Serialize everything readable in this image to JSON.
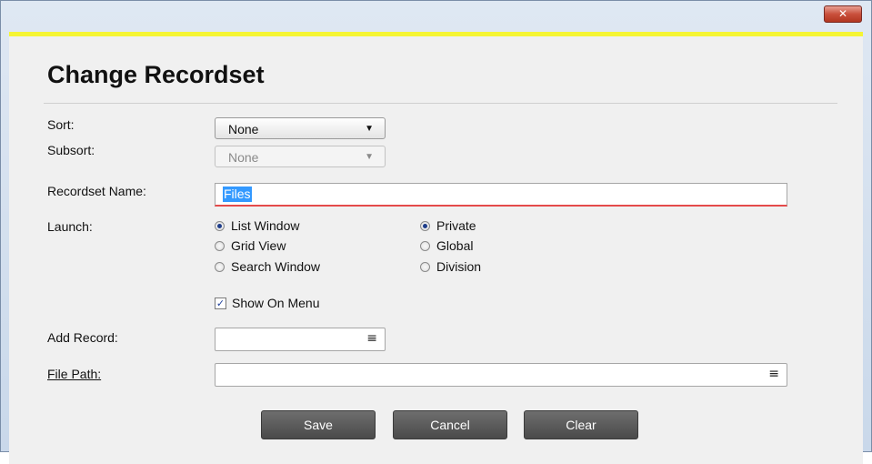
{
  "window": {
    "close_glyph": "✕"
  },
  "title": "Change Recordset",
  "fields": {
    "sort": {
      "label": "Sort:",
      "value": "None"
    },
    "subsort": {
      "label": "Subsort:",
      "value": "None"
    },
    "recordset_name": {
      "label": "Recordset Name:",
      "value": "Files"
    },
    "launch": {
      "label": "Launch:",
      "options": [
        "List Window",
        "Grid View",
        "Search Window"
      ],
      "selected": "List Window"
    },
    "scope": {
      "options": [
        "Private",
        "Global",
        "Division"
      ],
      "selected": "Private"
    },
    "show_on_menu": {
      "label": "Show On Menu",
      "checked": true
    },
    "add_record": {
      "label": "Add Record:",
      "value": ""
    },
    "file_path": {
      "label": "File Path:",
      "value": ""
    }
  },
  "buttons": {
    "save": "Save",
    "cancel": "Cancel",
    "clear": "Clear"
  },
  "icons": {
    "dropdown": "chevron-down-icon",
    "lookup": "list-icon"
  },
  "colors": {
    "accent_stripe": "#f5f533",
    "button_bg": "#5a5a5a",
    "selection": "#3399ff",
    "close_button": "#c9503c"
  }
}
